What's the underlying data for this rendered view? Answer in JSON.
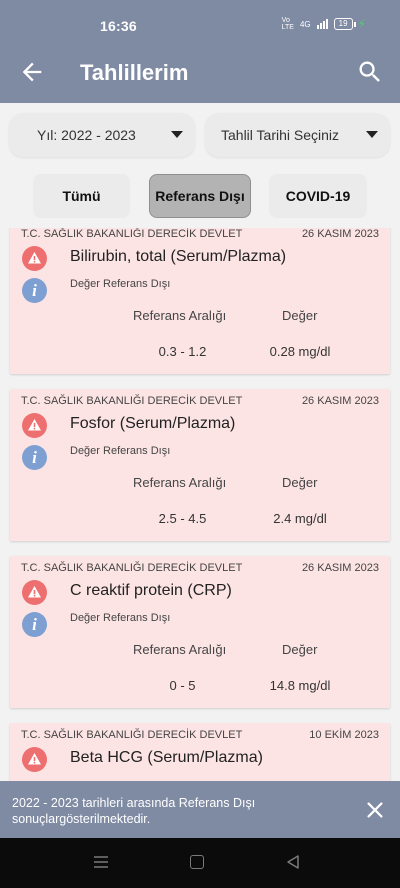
{
  "status_bar": {
    "time": "16:36",
    "network": "4G",
    "battery": "19"
  },
  "app_bar": {
    "title": "Tahlillerim"
  },
  "filters": {
    "year_label": "Yıl: 2022 - 2023",
    "date_placeholder": "Tahlil Tarihi Seçiniz",
    "chips": [
      "Tümü",
      "Referans Dışı",
      "COVID-19"
    ],
    "active_chip": "Referans Dışı"
  },
  "results": [
    {
      "institution": "T.C. SAĞLIK BAKANLIĞI DERECİK DEVLET",
      "date": "26 KASIM 2023",
      "test": "Bilirubin, total (Serum/Plazma)",
      "status": "Değer Referans Dışı",
      "range_header": "Referans Aralığı",
      "value_header": "Değer",
      "range": "0.3 - 1.2",
      "value": "0.28 mg/dl"
    },
    {
      "institution": "T.C. SAĞLIK BAKANLIĞI DERECİK DEVLET",
      "date": "26 KASIM 2023",
      "test": "Fosfor (Serum/Plazma)",
      "status": "Değer Referans Dışı",
      "range_header": "Referans Aralığı",
      "value_header": "Değer",
      "range": "2.5 - 4.5",
      "value": "2.4 mg/dl"
    },
    {
      "institution": "T.C. SAĞLIK BAKANLIĞI DERECİK DEVLET",
      "date": "26 KASIM 2023",
      "test": "C reaktif protein (CRP)",
      "status": "Değer Referans Dışı",
      "range_header": "Referans Aralığı",
      "value_header": "Değer",
      "range": "0 - 5",
      "value": "14.8 mg/dl"
    },
    {
      "institution": "T.C. SAĞLIK BAKANLIĞI DERECİK DEVLET",
      "date": "10 EKİM 2023",
      "test": "Beta HCG (Serum/Plazma)",
      "status": "",
      "range_header": "",
      "value_header": "",
      "range": "",
      "value": ""
    }
  ],
  "snackbar": {
    "message": "2022 - 2023 tarihleri arasında Referans Dışı sonuçlargösterilmektedir."
  },
  "colors": {
    "primary": "#7f8aa3",
    "card_background": "#fde4e4",
    "warning": "#ee6f6f",
    "info": "#7e9fd1"
  }
}
